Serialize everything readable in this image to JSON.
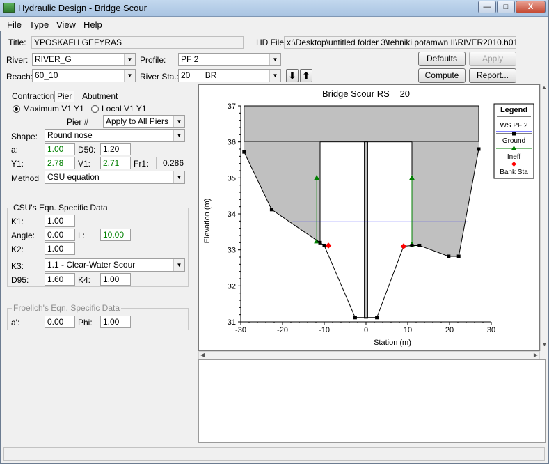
{
  "window": {
    "title": "Hydraulic Design - Bridge Scour",
    "controls": {
      "minimize": "—",
      "maximize": "□",
      "close": "X"
    }
  },
  "menu": [
    "File",
    "Type",
    "View",
    "Help"
  ],
  "header": {
    "title_label": "Title:",
    "title_value": "YPOSKAFH GEFYRAS",
    "hdfile_label": "HD File:",
    "hdfile_value": "x:\\Desktop\\untitled folder 3\\tehniki potamwn II\\RIVER2010.h01",
    "river_label": "River:",
    "river_value": "RIVER_G",
    "profile_label": "Profile:",
    "profile_value": "PF 2",
    "reach_label": "Reach:",
    "reach_value": "60_10",
    "riversta_label": "River Sta.:",
    "riversta_value": "20",
    "riversta_type": "BR",
    "down_arrow": "⬇",
    "up_arrow": "⬆"
  },
  "buttons": {
    "defaults": "Defaults",
    "apply": "Apply",
    "compute": "Compute",
    "report": "Report..."
  },
  "tabs": [
    "Contraction",
    "Pier",
    "Abutment"
  ],
  "pier": {
    "radio_max": "Maximum V1 Y1",
    "radio_local": "Local V1 Y1",
    "pier_num_label": "Pier #",
    "pier_num_value": "Apply to All Piers",
    "shape_label": "Shape:",
    "shape_value": "Round nose",
    "a_label": "a:",
    "a_value": "1.00",
    "d50_label": "D50:",
    "d50_value": "1.20",
    "y1_label": "Y1:",
    "y1_value": "2.78",
    "v1_label": "V1:",
    "v1_value": "2.71",
    "fr1_label": "Fr1:",
    "fr1_value": "0.286",
    "method_label": "Method",
    "method_value": "CSU equation"
  },
  "csu": {
    "title": "CSU's Eqn. Specific Data",
    "k1_label": "K1:",
    "k1_value": "1.00",
    "angle_label": "Angle:",
    "angle_value": "0.00",
    "l_label": "L:",
    "l_value": "10.00",
    "k2_label": "K2:",
    "k2_value": "1.00",
    "k3_label": "K3:",
    "k3_value": "1.1 - Clear-Water Scour",
    "d95_label": "D95:",
    "d95_value": "1.60",
    "k4_label": "K4:",
    "k4_value": "1.00"
  },
  "froelich": {
    "title": "Froelich's Eqn. Specific Data",
    "a_label": "a':",
    "a_value": "0.00",
    "phi_label": "Phi:",
    "phi_value": "1.00"
  },
  "colors": {
    "deck_fill": "#c0c0c0",
    "ws_line": "#0000ff",
    "ground": "#000000",
    "ineff": "#008000",
    "bank": "#ff0000"
  },
  "chart_data": {
    "type": "line",
    "title": "Bridge Scour RS = 20",
    "xlabel": "Station (m)",
    "ylabel": "Elevation (m)",
    "xlim": [
      -30,
      30
    ],
    "ylim": [
      31,
      37
    ],
    "x_ticks": [
      "-30",
      "-20",
      "-10",
      "0",
      "10",
      "20",
      "30"
    ],
    "y_ticks": [
      "31",
      "32",
      "33",
      "34",
      "35",
      "36",
      "37"
    ],
    "legend": {
      "title": "Legend",
      "position": "right",
      "entries": [
        "WS PF 2",
        "Ground",
        "Ineff",
        "Bank Sta"
      ]
    },
    "series": [
      {
        "name": "Ground",
        "x": [
          -29.2,
          -22.6,
          -11.0,
          -10.0,
          -2.6,
          2.6,
          9.0,
          11.0,
          12.8,
          19.8,
          22.2,
          27.0
        ],
        "y": [
          35.72,
          34.12,
          33.2,
          33.12,
          31.12,
          31.12,
          33.1,
          33.12,
          33.12,
          32.82,
          32.82,
          35.8
        ]
      },
      {
        "name": "WS PF 2",
        "x": [
          -17.6,
          24.5
        ],
        "y": [
          33.78,
          33.78
        ]
      },
      {
        "name": "Ineff",
        "x": [
          -11.0,
          11.0
        ],
        "y": [
          35.08,
          35.08
        ]
      },
      {
        "name": "Bank Sta",
        "x": [
          -9.0,
          9.0
        ],
        "y": [
          33.12,
          33.1
        ]
      }
    ],
    "bridge_deck": {
      "x": [
        -29.2,
        27.0
      ],
      "low_chord": 36.0,
      "high_chord": 37.0
    },
    "pier": {
      "x": [
        -0.4,
        0.4
      ],
      "bottom": 31.1,
      "top": 36.0
    },
    "ineff_areas": [
      {
        "x": -11.0,
        "bottom": 33.2,
        "top": 35.08
      },
      {
        "x": 11.0,
        "bottom": 33.12,
        "top": 35.08
      }
    ]
  }
}
